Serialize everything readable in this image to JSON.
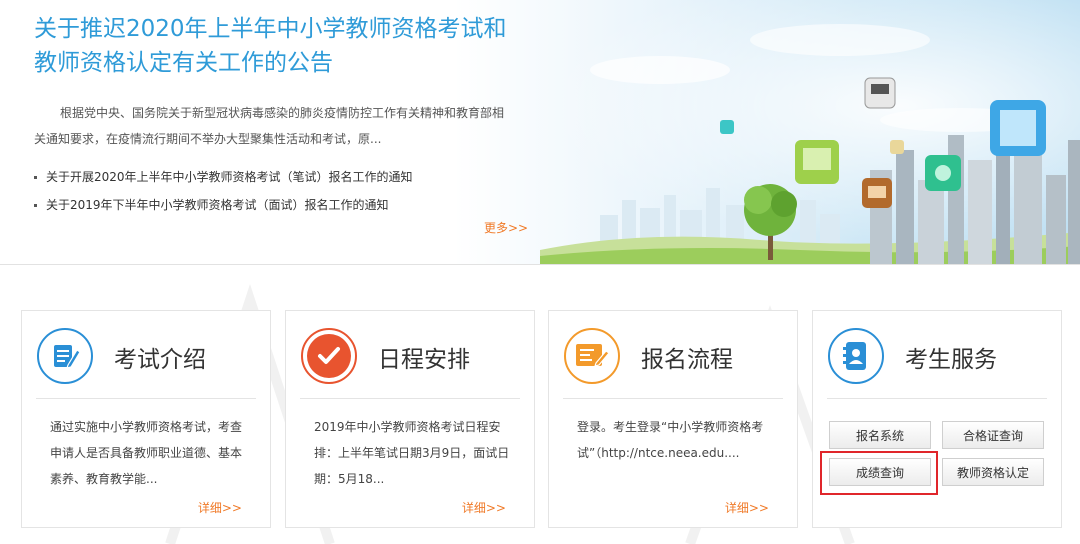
{
  "banner": {
    "headline": "关于推迟2020年上半年中小学教师资格考试和教师资格认定有关工作的公告",
    "summary": "根据党中央、国务院关于新型冠状病毒感染的肺炎疫情防控工作有关精神和教育部相关通知要求，在疫情流行期间不举办大型聚集性活动和考试，原...",
    "notices": [
      "关于开展2020年上半年中小学教师资格考试（笔试）报名工作的通知",
      "关于2019年下半年中小学教师资格考试（面试）报名工作的通知"
    ],
    "more_label": "更多>>"
  },
  "cards": {
    "exam_intro": {
      "title": "考试介绍",
      "desc": "通过实施中小学教师资格考试，考查申请人是否具备教师职业道德、基本素养、教育教学能...",
      "more_label": "详细>>"
    },
    "schedule": {
      "title": "日程安排",
      "desc": "2019年中小学教师资格考试日程安排：上半年笔试日期3月9日，面试日期：5月18...",
      "more_label": "详细>>"
    },
    "registration": {
      "title": "报名流程",
      "desc": "登录。考生登录“中小学教师资格考试”（http://ntce.neea.edu....",
      "more_label": "详细>>"
    },
    "services": {
      "title": "考生服务",
      "buttons": {
        "registration_system": "报名系统",
        "certificate_query": "合格证查询",
        "score_query": "成绩查询",
        "qualification_certification": "教师资格认定"
      }
    }
  },
  "colors": {
    "headline_blue": "#2f9bd8",
    "link_orange": "#f07a28",
    "icon_blue": "#2a8fd6",
    "icon_red": "#e8542f",
    "icon_orange": "#f39a2b",
    "highlight_red": "#e0262b"
  },
  "icons": {
    "exam_intro": "document-pencil-icon",
    "schedule": "checkmark-icon",
    "registration": "form-edit-icon",
    "services": "address-book-icon"
  }
}
